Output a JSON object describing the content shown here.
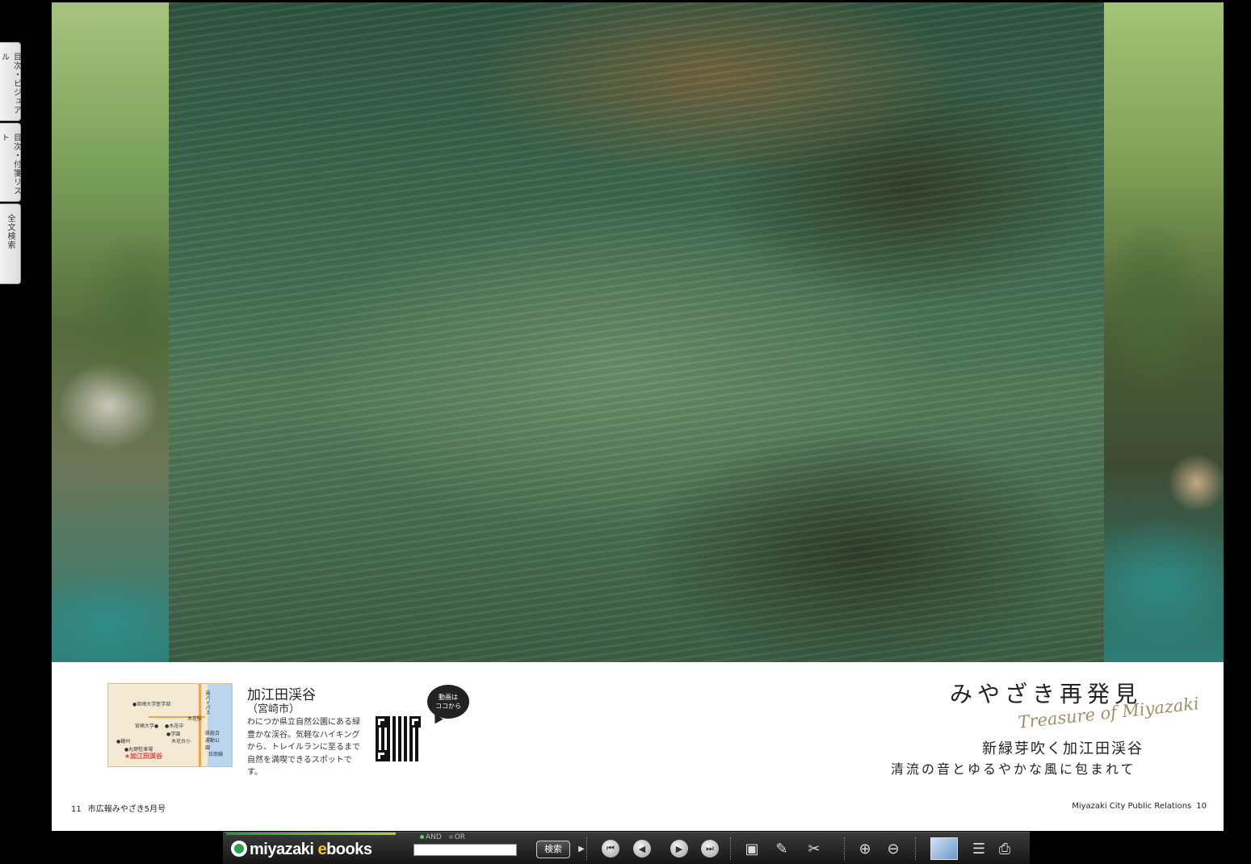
{
  "side_tabs": [
    {
      "label": "目次・ビジュアル"
    },
    {
      "label": "目次・付箋リスト"
    },
    {
      "label": "全文検索"
    }
  ],
  "caption": {
    "spot_title": "加江田渓谷",
    "spot_sub": "（宮崎市）",
    "spot_desc": "わにつか県立自然公園にある緑豊かな渓谷。気軽なハイキングから、トレイルランに至るまで自然を満喫できるスポットです。",
    "video_bubble_line1": "動画は",
    "video_bubble_line2": "ココから",
    "map_labels": {
      "univ": "●宮崎大学医学部",
      "station": "宮崎大学●",
      "bypass": "南バイパス",
      "hospital": "●木花中",
      "kibana": "木花駅",
      "school": "●学園",
      "kibana_sho": "木花台小",
      "park": "県総合運動公園",
      "sotoura": "●鏡州",
      "parking": "●丸野駐車場",
      "kaeda": "加江田渓谷",
      "route": "日南線"
    },
    "headline": "みやざき再発見",
    "script": "Treasure of Miyazaki",
    "subhead": "新緑芽吹く加江田渓谷",
    "subhead2": "清流の音とゆるやかな風に包まれて"
  },
  "folio": {
    "left_num": "11",
    "left_text": "市広報みやざき5月号",
    "right_text": "Miyazaki City Public Relations",
    "right_num": "10"
  },
  "toolbar": {
    "brand_prefix": "miyazaki ",
    "brand_e": "e",
    "brand_suffix": "books",
    "mode_and": "AND",
    "mode_or": "OR",
    "search_value": "",
    "search_label": "検索",
    "icons": [
      "first-page-icon",
      "prev-page-icon",
      "next-page-icon",
      "last-page-icon",
      "bookmark-icon",
      "pen-icon",
      "clip-icon",
      "zoom-in-icon",
      "zoom-out-icon",
      "thumbnail-icon",
      "index-icon",
      "print-icon"
    ]
  }
}
